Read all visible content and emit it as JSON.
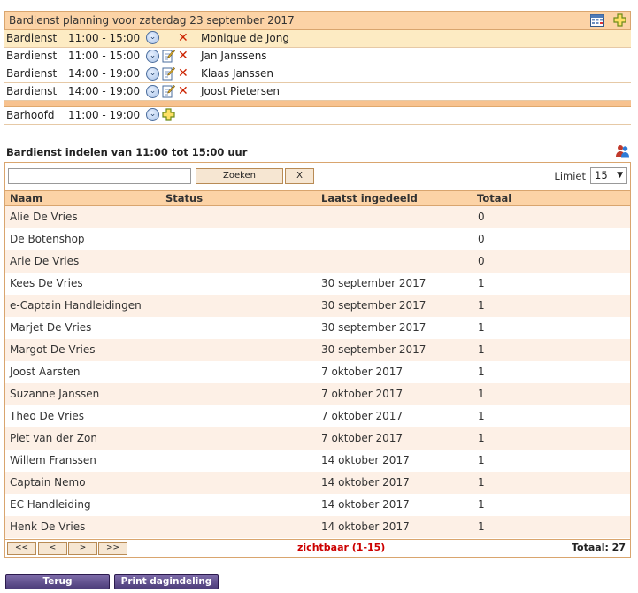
{
  "planning": {
    "title": "Bardienst planning voor zaterdag 23 september 2017",
    "header_icons": [
      "calendar-icon",
      "plus-icon"
    ],
    "shifts": [
      {
        "role": "Bardienst",
        "time": "11:00 - 15:00",
        "person": "Monique de Jong",
        "has_edit": false,
        "highlight": true
      },
      {
        "role": "Bardienst",
        "time": "11:00 - 15:00",
        "person": "Jan Janssens",
        "has_edit": true,
        "highlight": false
      },
      {
        "role": "Bardienst",
        "time": "14:00 - 19:00",
        "person": "Klaas Janssen",
        "has_edit": true,
        "highlight": false
      },
      {
        "role": "Bardienst",
        "time": "14:00 - 19:00",
        "person": "Joost Pietersen",
        "has_edit": true,
        "highlight": false
      }
    ],
    "head_shift": {
      "role": "Barhoofd",
      "time": "11:00 - 19:00"
    }
  },
  "assign": {
    "title": "Bardienst indelen van 11:00 tot 15:00 uur",
    "search": {
      "placeholder": "",
      "value": "",
      "search_label": "Zoeken",
      "clear_label": "X"
    },
    "limit_label": "Limiet",
    "limit_value": "15",
    "columns": {
      "name": "Naam",
      "status": "Status",
      "last": "Laatst ingedeeld",
      "total": "Totaal"
    },
    "rows": [
      {
        "name": "Alie De Vries",
        "status": "",
        "last": "",
        "total": "0"
      },
      {
        "name": "De Botenshop",
        "status": "",
        "last": "",
        "total": "0"
      },
      {
        "name": "Arie De Vries",
        "status": "",
        "last": "",
        "total": "0"
      },
      {
        "name": "Kees De Vries",
        "status": "",
        "last": "30 september 2017",
        "total": "1"
      },
      {
        "name": "e-Captain Handleidingen",
        "status": "",
        "last": "30 september 2017",
        "total": "1"
      },
      {
        "name": "Marjet De Vries",
        "status": "",
        "last": "30 september 2017",
        "total": "1"
      },
      {
        "name": "Margot De Vries",
        "status": "",
        "last": "30 september 2017",
        "total": "1"
      },
      {
        "name": "Joost Aarsten",
        "status": "",
        "last": "7 oktober 2017",
        "total": "1"
      },
      {
        "name": "Suzanne Janssen",
        "status": "",
        "last": "7 oktober 2017",
        "total": "1"
      },
      {
        "name": "Theo De Vries",
        "status": "",
        "last": "7 oktober 2017",
        "total": "1"
      },
      {
        "name": "Piet van der Zon",
        "status": "",
        "last": "7 oktober 2017",
        "total": "1"
      },
      {
        "name": "Willem Franssen",
        "status": "",
        "last": "14 oktober 2017",
        "total": "1"
      },
      {
        "name": "Captain Nemo",
        "status": "",
        "last": "14 oktober 2017",
        "total": "1"
      },
      {
        "name": "EC Handleiding",
        "status": "",
        "last": "14 oktober 2017",
        "total": "1"
      },
      {
        "name": "Henk De Vries",
        "status": "",
        "last": "14 oktober 2017",
        "total": "1"
      }
    ],
    "pager": {
      "first": "<<",
      "prev": "<",
      "next": ">",
      "last": ">>",
      "visible": "zichtbaar (1-15)",
      "total": "Totaal: 27"
    }
  },
  "buttons": {
    "back": "Terug",
    "print": "Print dagindeling"
  },
  "colors": {
    "header_bg": "#fcd3a6",
    "highlight_row": "#fdebc3",
    "row_alt": "#fdf0e6",
    "delete": "#cc2200",
    "button_purple": "#5a4888",
    "pager_text": "#cc0000"
  }
}
